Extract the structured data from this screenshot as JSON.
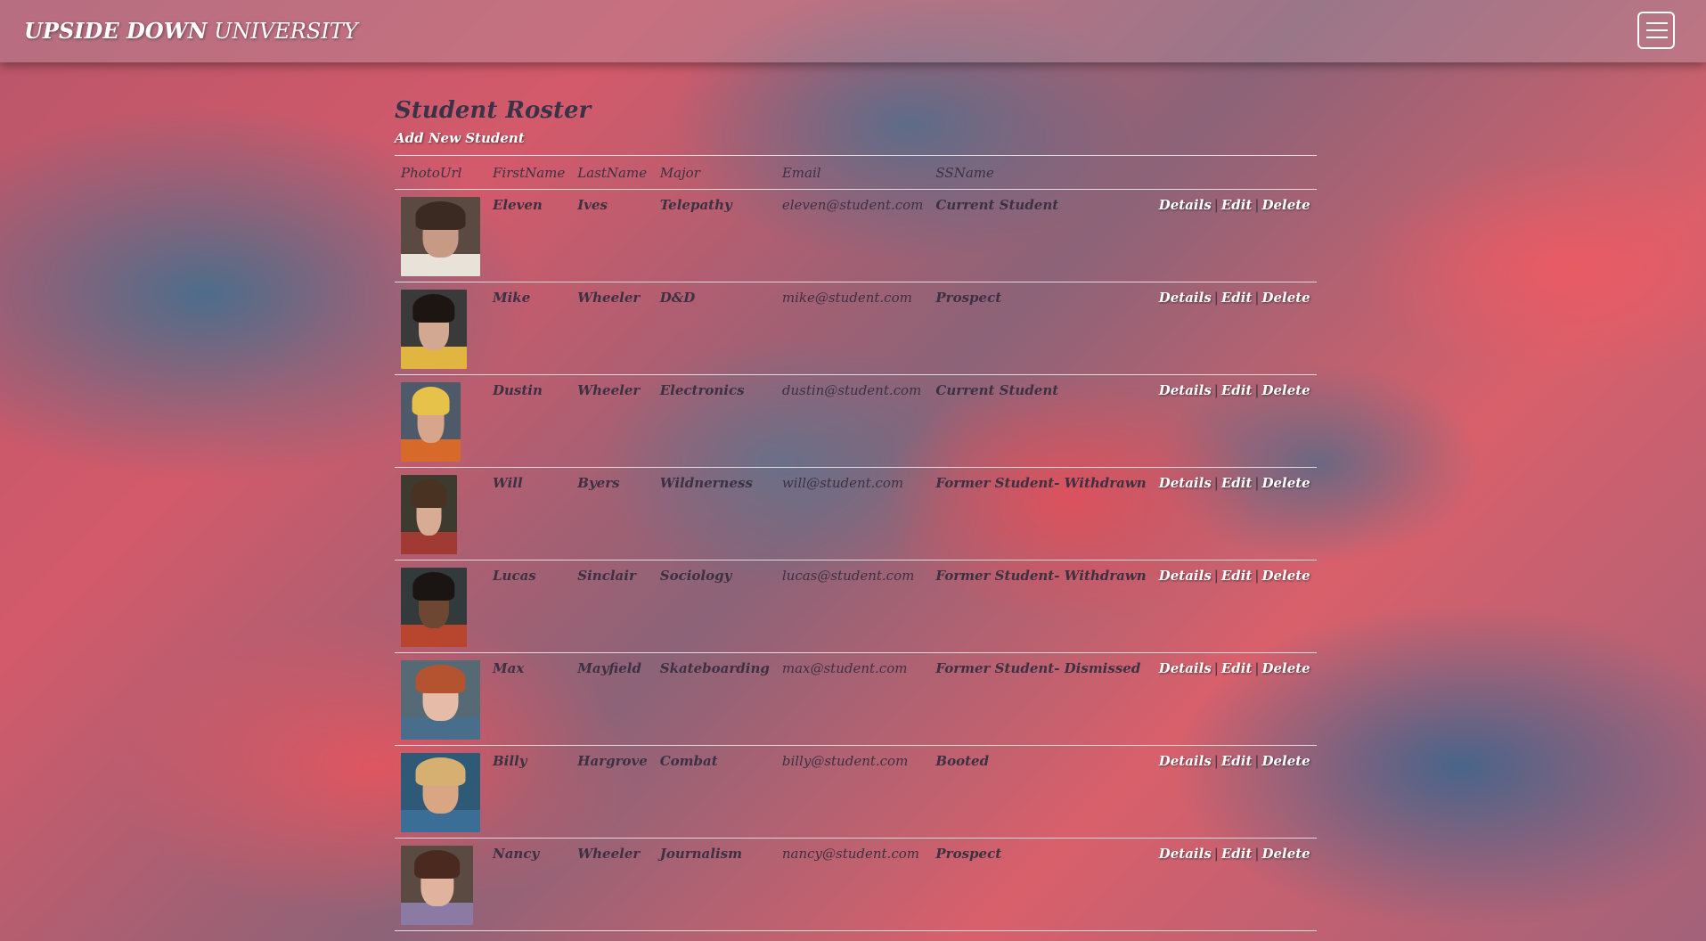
{
  "brand": {
    "bold": "UPSIDE DOWN",
    "light": "UNIVERSITY"
  },
  "page_title": "Student Roster",
  "add_link": "Add New Student",
  "columns": [
    "PhotoUrl",
    "FirstName",
    "LastName",
    "Major",
    "Email",
    "SSName"
  ],
  "actions": {
    "details": "Details",
    "edit": "Edit",
    "delete": "Delete",
    "separator": "|"
  },
  "students": [
    {
      "first": "Eleven",
      "last": "Ives",
      "major": "Telepathy",
      "email": "eleven@student.com",
      "status": "Current Student",
      "photo_w": 89,
      "bg": "#5b4a42",
      "hair": "#3a2a22",
      "face": "#c79a86",
      "shirt": "#e9e2d8"
    },
    {
      "first": "Mike",
      "last": "Wheeler",
      "major": "D&D",
      "email": "mike@student.com",
      "status": "Prospect",
      "photo_w": 74,
      "bg": "#3a3a3a",
      "hair": "#1c1512",
      "face": "#d2a893",
      "shirt": "#e0b640"
    },
    {
      "first": "Dustin",
      "last": "Wheeler",
      "major": "Electronics",
      "email": "dustin@student.com",
      "status": "Current Student",
      "photo_w": 67,
      "bg": "#4e5a6a",
      "hair": "#e6c24a",
      "face": "#d7a58c",
      "shirt": "#d76a2a"
    },
    {
      "first": "Will",
      "last": "Byers",
      "major": "Wildnerness",
      "email": "will@student.com",
      "status": "Former Student- Withdrawn",
      "photo_w": 63,
      "bg": "#3d3a30",
      "hair": "#4a3222",
      "face": "#d8ab94",
      "shirt": "#a23a34"
    },
    {
      "first": "Lucas",
      "last": "Sinclair",
      "major": "Sociology",
      "email": "lucas@student.com",
      "status": "Former Student- Withdrawn",
      "photo_w": 74,
      "bg": "#323a3c",
      "hair": "#1a1412",
      "face": "#6e4733",
      "shirt": "#b8452e"
    },
    {
      "first": "Max",
      "last": "Mayfield",
      "major": "Skateboarding",
      "email": "max@student.com",
      "status": "Former Student- Dismissed",
      "photo_w": 89,
      "bg": "#556a74",
      "hair": "#b4532f",
      "face": "#e6bca6",
      "shirt": "#486e8c"
    },
    {
      "first": "Billy",
      "last": "Hargrove",
      "major": "Combat",
      "email": "billy@student.com",
      "status": "Booted",
      "photo_w": 89,
      "bg": "#2e5a78",
      "hair": "#d5b070",
      "face": "#d9a684",
      "shirt": "#3a6e96"
    },
    {
      "first": "Nancy",
      "last": "Wheeler",
      "major": "Journalism",
      "email": "nancy@student.com",
      "status": "Prospect",
      "photo_w": 81,
      "bg": "#5a4a42",
      "hair": "#4a2a1e",
      "face": "#dfb39d",
      "shirt": "#8a7aa4"
    }
  ]
}
